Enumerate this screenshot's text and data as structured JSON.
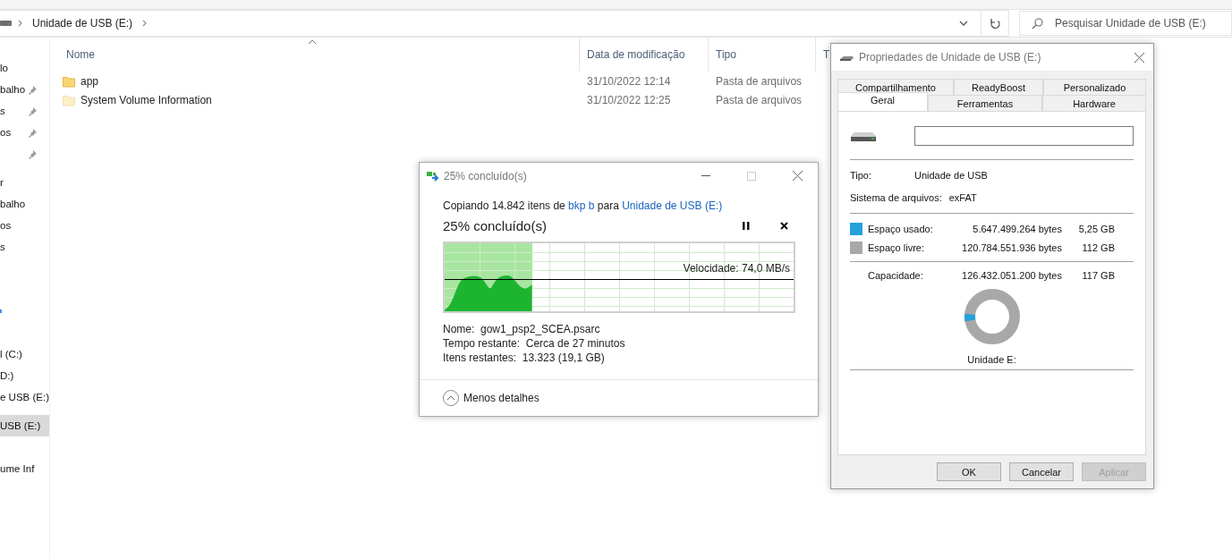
{
  "explorer": {
    "breadcrumb": "Unidade de USB (E:)",
    "search": {
      "placeholder": "Pesquisar Unidade de USB (E:)"
    },
    "sidebar": {
      "groups": [
        {
          "items": [
            {
              "label": "lo",
              "pinned": false,
              "selected": false
            },
            {
              "label": "balho",
              "pinned": true,
              "selected": false
            },
            {
              "label": "s",
              "pinned": true,
              "selected": false
            },
            {
              "label": "os",
              "pinned": true,
              "selected": false
            },
            {
              "pinned": true,
              "selected": false
            }
          ]
        },
        {
          "items": [
            {
              "label": "r",
              "pinned": false,
              "selected": false
            },
            {
              "label": "balho",
              "pinned": false,
              "selected": false
            },
            {
              "label": "os",
              "pinned": false,
              "selected": false
            },
            {
              "label": "s",
              "pinned": false,
              "selected": false
            }
          ]
        },
        {
          "items": [
            {
              "kind": "icon-fragment",
              "pinned": false,
              "selected": false
            }
          ]
        },
        {
          "items": [
            {
              "label": "l (C:)",
              "pinned": false,
              "selected": false
            },
            {
              "label": "D:)",
              "pinned": false,
              "selected": false
            },
            {
              "label": "e USB (E:)",
              "pinned": false,
              "selected": false
            }
          ]
        },
        {
          "items": [
            {
              "label": "USB (E:)",
              "pinned": false,
              "selected": true
            }
          ]
        },
        {
          "items": [
            {
              "label": "ume Inf",
              "pinned": false,
              "selected": false
            }
          ]
        }
      ]
    },
    "columns": [
      "Nome",
      "Data de modificação",
      "Tipo",
      "T"
    ],
    "rows": [
      {
        "kind": "folder",
        "name": "app",
        "modified": "31/10/2022 12:14",
        "type": "Pasta de arquivos"
      },
      {
        "kind": "hidden-folder",
        "name": "System Volume Information",
        "modified": "31/10/2022 12:25",
        "type": "Pasta de arquivos"
      }
    ]
  },
  "copy_dialog": {
    "title": "25% concluído(s)",
    "summary": {
      "prefix": "Copiando 14.842 itens de",
      "source": "bkp b",
      "middle": "para",
      "destination": "Unidade de USB (E:)"
    },
    "heading": "25% concluído(s)",
    "progress": {
      "level": 0.25
    },
    "speed": "Velocidade: 74,0 MB/s",
    "details": [
      {
        "label": "Nome:",
        "value": "gow1_psp2_SCEA.psarc"
      },
      {
        "label": "Tempo restante:",
        "value": "Cerca de 27 minutos"
      },
      {
        "label": "Itens restantes:",
        "value": "13.323 (19,1 GB)"
      }
    ],
    "toggle": "Menos detalhes"
  },
  "properties_dialog": {
    "title": "Propriedades de Unidade de USB (E:)",
    "tab_rows": [
      [
        {
          "label": "Compartilhamento",
          "selected": false
        },
        {
          "label": "ReadyBoost",
          "selected": false
        },
        {
          "label": "Personalizado",
          "selected": false
        }
      ],
      [
        {
          "label": "Geral",
          "selected": true
        },
        {
          "label": "Ferramentas",
          "selected": false
        },
        {
          "label": "Hardware",
          "selected": false
        }
      ]
    ],
    "type": {
      "label": "Tipo:",
      "value": "Unidade de USB"
    },
    "file_system": {
      "label": "Sistema de arquivos:",
      "value": "exFAT"
    },
    "usage": [
      {
        "label": "Espaço usado:",
        "bytes": "5.647.499.264 bytes",
        "size": "5,25 GB",
        "color": "#26a0da"
      },
      {
        "label": "Espaço livre:",
        "bytes": "120.784.551.936 bytes",
        "size": "112 GB",
        "color": "#a8a8a8"
      }
    ],
    "capacity": {
      "label": "Capacidade:",
      "bytes": "126.432.051.200 bytes",
      "size": "117 GB"
    },
    "donut": {
      "level": 0.045
    },
    "drive_label": "Unidade E:",
    "buttons": [
      {
        "label": "OK",
        "disabled": false
      },
      {
        "label": "Cancelar",
        "disabled": false
      },
      {
        "label": "Aplicar",
        "disabled": true
      }
    ]
  }
}
